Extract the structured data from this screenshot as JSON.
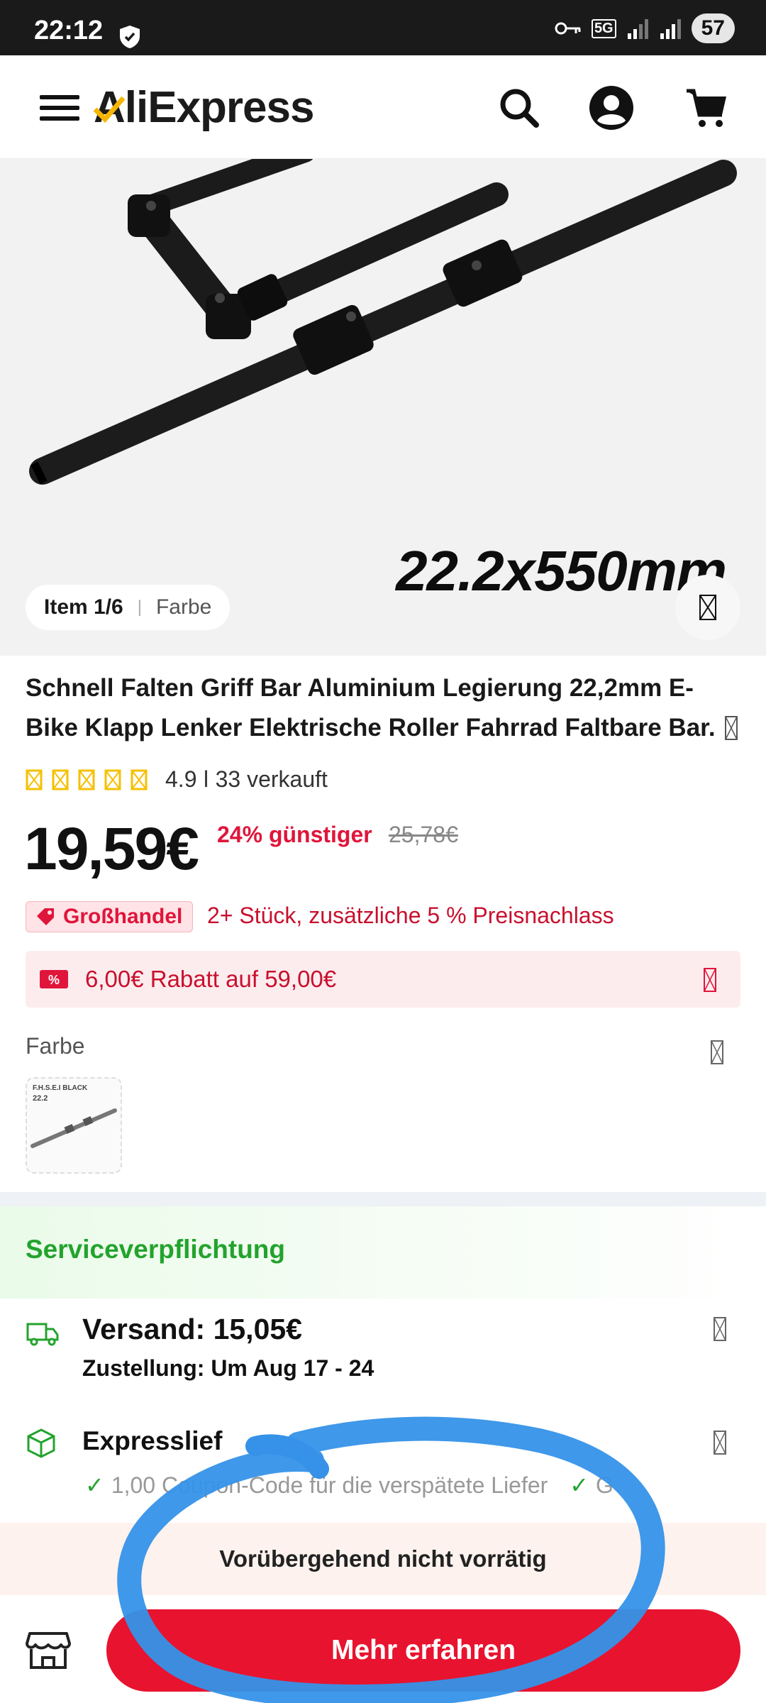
{
  "status_bar": {
    "time": "22:12",
    "network": "5G",
    "battery": "57"
  },
  "header": {
    "logo_text": "AliExpress",
    "icons": [
      "menu-icon",
      "search-icon",
      "account-icon",
      "cart-icon"
    ]
  },
  "gallery": {
    "image_caption": "22.2x550mm",
    "item_counter": "Item 1/6",
    "attribute": "Farbe"
  },
  "product": {
    "title": "Schnell Falten Griff Bar Aluminium Legierung 22,2mm E-Bike Klapp Lenker Elektrische Roller Fahrrad Faltbare Bar.",
    "rating_text": "4.9 ǀ 33 verkauft",
    "stars": 5,
    "price": "19,59€",
    "discount": "24% günstiger",
    "original_price": "25,78€"
  },
  "promotions": {
    "wholesale_label": "Großhandel",
    "wholesale_text": "2+ Stück, zusätzliche 5 % Preisnachlass",
    "coupon_text": "6,00€ Rabatt auf 59,00€"
  },
  "variants": {
    "label": "Farbe",
    "swatch_tag": "F.H.S.E.I BLACK",
    "swatch_size": "22.2"
  },
  "service": {
    "title": "Serviceverpflichtung",
    "shipping_title": "Versand: 15,05€",
    "shipping_sub": "Zustellung: Um Aug 17 - 24",
    "express_title": "Expresslief",
    "express_line": "1,00 Coupon-Code für die verspätete Liefer",
    "express_line_tail": "G"
  },
  "footer": {
    "out_of_stock": "Vorübergehend nicht vorrätig",
    "cta_label": "Mehr erfahren"
  },
  "colors": {
    "brand_red": "#e8132f",
    "service_green": "#23a32d",
    "annotation_blue": "#3592e8"
  }
}
